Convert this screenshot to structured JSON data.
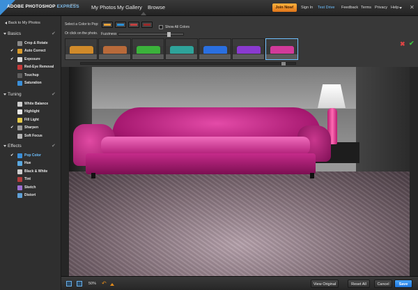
{
  "app": {
    "brand": "ADOBE",
    "product": "PHOTOSHOP",
    "edition": "EXPRESS",
    "badge": "BETA"
  },
  "nav": {
    "items": [
      {
        "label": "My Photos"
      },
      {
        "label": "My Gallery"
      },
      {
        "label": "Browse"
      }
    ]
  },
  "top_links": {
    "join": "Join Now!",
    "sign_in": "Sign In",
    "test_drive": "Test Drive",
    "feedback": "Feedback",
    "terms": "Terms",
    "privacy": "Privacy",
    "help": "Help",
    "close": "✕"
  },
  "sidebar": {
    "back": "Back to My Photos",
    "sections": [
      {
        "title": "Basics",
        "items": [
          {
            "label": "Crop & Rotate",
            "done": "",
            "icon_color": "#8a8a8a"
          },
          {
            "label": "Auto Correct",
            "done": "✔",
            "icon_color": "#d99b2b"
          },
          {
            "label": "Exposure",
            "done": "✔",
            "icon_color": "#d9d9d9"
          },
          {
            "label": "Red-Eye Removal",
            "done": "",
            "icon_color": "#c73a3a"
          },
          {
            "label": "Touchup",
            "done": "",
            "icon_color": "#5e5e5e"
          },
          {
            "label": "Saturation",
            "done": "",
            "icon_color": "#3a8fd9"
          }
        ]
      },
      {
        "title": "Tuning",
        "items": [
          {
            "label": "White Balance",
            "done": "",
            "icon_color": "#cfcfcf"
          },
          {
            "label": "Highlight",
            "done": "",
            "icon_color": "#e8e8e8"
          },
          {
            "label": "Fill Light",
            "done": "",
            "icon_color": "#e4c94a"
          },
          {
            "label": "Sharpen",
            "done": "✔",
            "icon_color": "#9a9a9a"
          },
          {
            "label": "Soft Focus",
            "done": "",
            "icon_color": "#b5b5b5"
          }
        ]
      },
      {
        "title": "Effects",
        "items": [
          {
            "label": "Pop Color",
            "done": "✔",
            "icon_color": "#3a8fd9",
            "active": true
          },
          {
            "label": "Hue",
            "done": "",
            "icon_color": "#5aa8e0"
          },
          {
            "label": "Black & White",
            "done": "",
            "icon_color": "#cccccc"
          },
          {
            "label": "Tint",
            "done": "",
            "icon_color": "#b33b3b"
          },
          {
            "label": "Sketch",
            "done": "",
            "icon_color": "#9c6fd1"
          },
          {
            "label": "Distort",
            "done": "",
            "icon_color": "#5fa0d6"
          }
        ]
      }
    ],
    "section_check": "✔"
  },
  "options": {
    "select_color_label": "Select a Color to Pop:",
    "or_click_label": "Or click on the photo.",
    "show_all_label": "Show All Colors",
    "fuzziness_label": "Fuzziness",
    "fuzziness_value": 0.79,
    "swatches": [
      {
        "name": "eyedropper-swatch",
        "color": "#e8a23a"
      },
      {
        "name": "blue-swatch",
        "color": "#2a8fd6"
      },
      {
        "name": "red-swatch",
        "color": "#c24040"
      },
      {
        "name": "dark-red-swatch",
        "color": "#9a2a2a"
      }
    ],
    "thumbnails": [
      {
        "color": "#d08a2a"
      },
      {
        "color": "#b86a3a"
      },
      {
        "color": "#3bb23b"
      },
      {
        "color": "#2ea39a"
      },
      {
        "color": "#2a6fe0"
      },
      {
        "color": "#8a3ad0"
      },
      {
        "color": "#d23a9a",
        "selected": true
      }
    ],
    "cancel": "✖",
    "accept": "✔"
  },
  "bottom": {
    "zoom": "50%",
    "undo": "↶",
    "view_original": "View Original",
    "reset_all": "Reset All",
    "cancel": "Cancel",
    "save": "Save"
  }
}
